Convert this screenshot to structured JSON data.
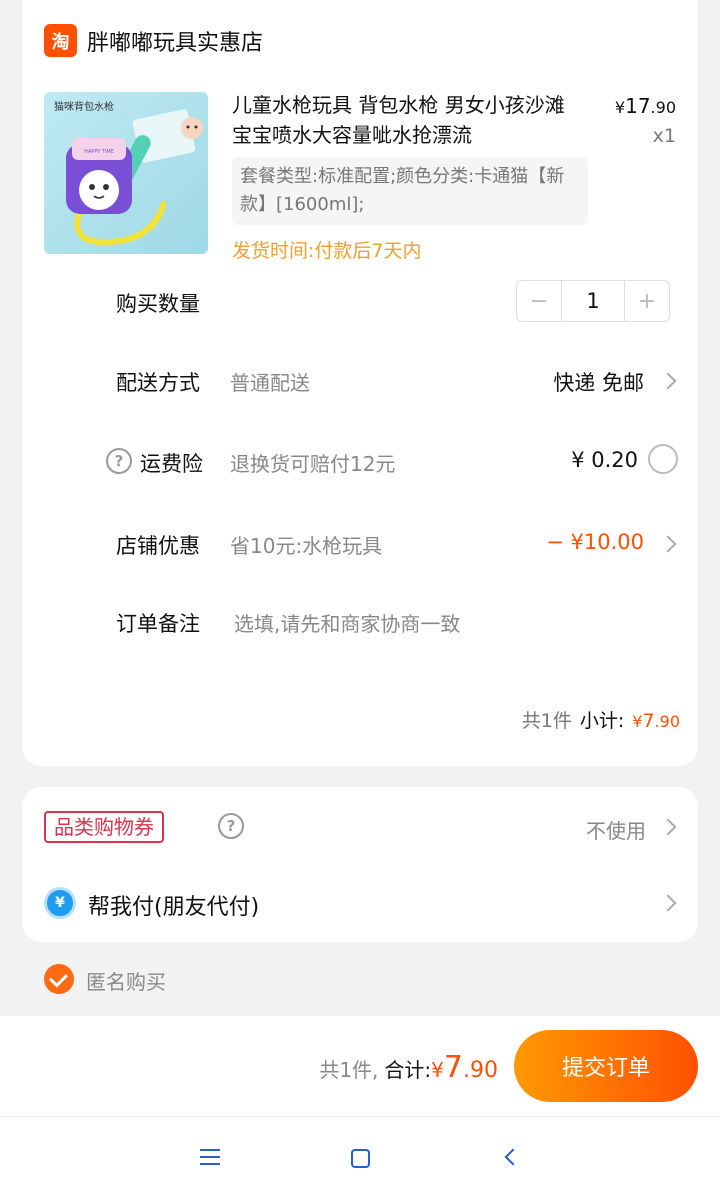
{
  "store": {
    "logo_text": "淘",
    "name": "胖嘟嘟玩具实惠店"
  },
  "product": {
    "image_label": "猫咪背包水枪",
    "image_badge": "HAPPY TIME",
    "title": "儿童水枪玩具 背包水枪 男女小孩沙滩宝宝喷水大容量呲水抢漂流",
    "price_symbol": "¥",
    "price_int": "17",
    "price_dec": ".90",
    "quantity": "x1",
    "sku": "套餐类型:标准配置;颜色分类:卡通猫【新款】[1600ml];",
    "ship_time": "发货时间:付款后7天内"
  },
  "quantity_row": {
    "label": "购买数量",
    "minus": "−",
    "value": "1",
    "plus": "+"
  },
  "delivery_row": {
    "label": "配送方式",
    "sub": "普通配送",
    "right": "快递 免邮"
  },
  "insurance_row": {
    "help": "?",
    "label": "运费险",
    "sub": "退换货可赔付12元",
    "right": "¥ 0.20"
  },
  "discount_row": {
    "label": "店铺优惠",
    "sub": "省10元:水枪玩具",
    "right": "− ¥10.00"
  },
  "note_row": {
    "label": "订单备注",
    "placeholder": "选填,请先和商家协商一致"
  },
  "subtotal": {
    "count": "共1件",
    "label": "小计:",
    "yen": "¥",
    "int": "7",
    "dec": ".90"
  },
  "coupon": {
    "tag": "品类购物券",
    "help": "?",
    "status": "不使用"
  },
  "friend_pay": {
    "icon": "¥",
    "label": "帮我付(朋友代付)"
  },
  "anonymous": {
    "label": "匿名购买",
    "checked": true
  },
  "bottom": {
    "count": "共1件,",
    "label": "合计:",
    "yen": "¥",
    "int": "7",
    "dec": ".90",
    "submit": "提交订单"
  },
  "colors": {
    "accent": "#ff5000",
    "ship_time": "#f0a02b",
    "coupon": "#e0324b",
    "nav": "#2a5bd7"
  }
}
